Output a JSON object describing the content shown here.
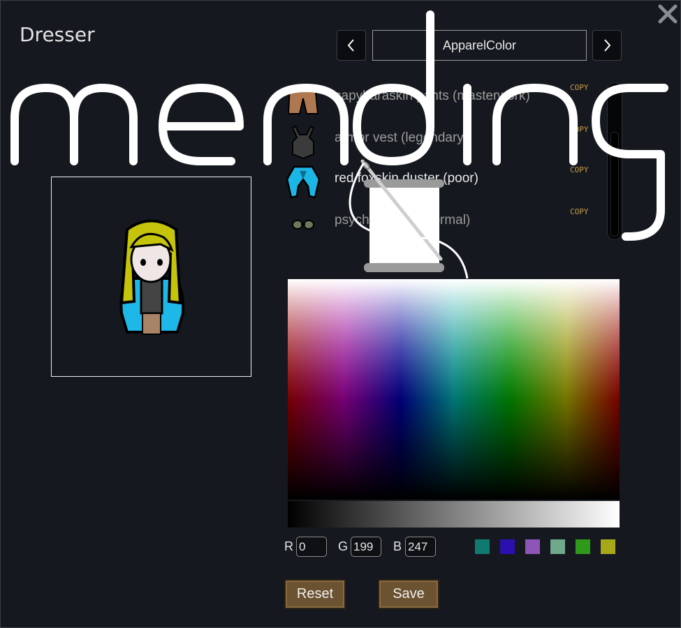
{
  "window": {
    "title": "Dresser"
  },
  "layer_selector": {
    "value": "ApparelColor",
    "prev_icon": "chevron-left-icon",
    "next_icon": "chevron-right-icon"
  },
  "apparel": [
    {
      "name": "capybaraskin pants (masterwork)",
      "copy": "COPY",
      "color": "#b07850",
      "selected": false
    },
    {
      "name": "armor vest (legendary)",
      "copy": "COPY",
      "color": "#3a3a3a",
      "selected": false
    },
    {
      "name": "red foxskin duster (poor)",
      "copy": "COPY",
      "color": "#00c7f7",
      "selected": true
    },
    {
      "name": "psychic shield (normal)",
      "copy": "COPY",
      "color": "#6a7a5a",
      "selected": false
    }
  ],
  "color": {
    "r": "0",
    "g": "199",
    "b": "247",
    "r_label": "R",
    "g_label": "G",
    "b_label": "B"
  },
  "swatches": [
    "#0f7a70",
    "#2b0fb0",
    "#8e55b8",
    "#6fa88a",
    "#2f9a1a",
    "#a7a817"
  ],
  "buttons": {
    "reset": "Reset",
    "save": "Save"
  },
  "watermark": {
    "text": "mending"
  }
}
